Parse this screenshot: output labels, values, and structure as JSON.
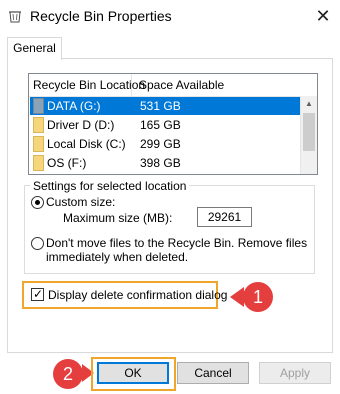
{
  "window": {
    "title": "Recycle Bin Properties",
    "close_glyph": "✕"
  },
  "tabs": [
    {
      "label": "General"
    }
  ],
  "list": {
    "headers": {
      "location": "Recycle Bin Location",
      "space": "Space Available"
    },
    "rows": [
      {
        "name": "DATA (G:)",
        "space": "531 GB",
        "selected": true
      },
      {
        "name": "Driver D (D:)",
        "space": "165 GB",
        "selected": false
      },
      {
        "name": "Local Disk (C:)",
        "space": "299 GB",
        "selected": false
      },
      {
        "name": "OS (F:)",
        "space": "398 GB",
        "selected": false
      }
    ]
  },
  "settings": {
    "group_label": "Settings for selected location",
    "custom_size_label": "Custom size:",
    "max_size_label": "Maximum size (MB):",
    "max_size_value": "29261",
    "dont_move_line1": "Don't move files to the Recycle Bin. Remove files",
    "dont_move_line2": "immediately when deleted."
  },
  "confirm": {
    "label": "Display delete confirmation dialog",
    "checked": true
  },
  "callouts": {
    "one": "1",
    "two": "2"
  },
  "buttons": {
    "ok": "OK",
    "cancel": "Cancel",
    "apply": "Apply"
  },
  "colors": {
    "selection": "#0078d7",
    "callout": "#e53e3e",
    "highlight": "#f0a52b"
  }
}
